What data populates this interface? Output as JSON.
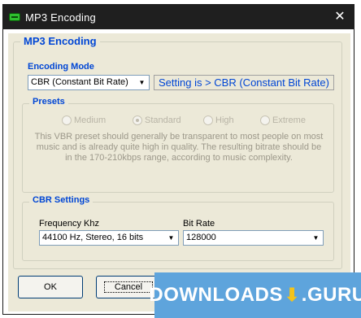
{
  "window": {
    "title": "MP3 Encoding",
    "close_glyph": "✕"
  },
  "main_group": {
    "title": "MP3 Encoding"
  },
  "encoding_mode": {
    "label": "Encoding Mode",
    "selected": "CBR (Constant Bit Rate)",
    "status": "Setting is > CBR (Constant Bit Rate)"
  },
  "presets": {
    "title": "Presets",
    "options": [
      "Medium",
      "Standard",
      "High",
      "Extreme"
    ],
    "selected": "Standard",
    "description": "This VBR preset should generally be transparent to most people on most music and is already quite high in quality. The resulting bitrate should be in the 170-210kbps range, according to music complexity."
  },
  "cbr_settings": {
    "title": "CBR Settings",
    "frequency_label": "Frequency Khz",
    "frequency_value": "44100 Hz, Stereo, 16 bits",
    "bitrate_label": "Bit Rate",
    "bitrate_value": "128000"
  },
  "buttons": {
    "ok": "OK",
    "cancel": "Cancel"
  },
  "watermark": {
    "left": "DOWNLOADS",
    "right": ".GURU"
  },
  "colors": {
    "title_bar": "#1f1f1f",
    "dialog_bg": "#ece9d8",
    "group_title": "#0046d5",
    "watermark_bg": "#5ea4dc"
  }
}
